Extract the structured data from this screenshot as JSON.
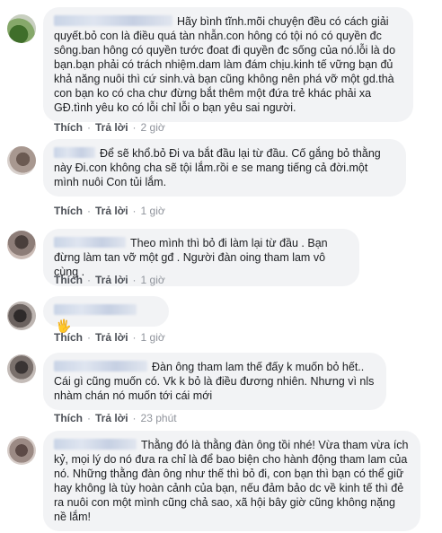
{
  "comments": [
    {
      "text": "Hãy bình tĩnh.mõi chuyện đều có cách giải quyết.bỏ con là điều quá tàn nhẫn.con hông có tội nó có quyền đc sông.ban hông có quyền tước đoat đi quyền đc sống của nó.lỗi là do bạn.bạn phải có trách nhiệm.dam làm đám chịu.kinh tế vững bạn đủ khả năng nuôi thì cứ sinh.và bạn cũng không nên phá vỡ một gd.thà con bạn ko có cha chư đừng bắt thêm một đứa trẻ khác phải xa GĐ.tình yêu ko có lỗi chỉ lỗi o bạn yêu sai người.",
      "like": "Thích",
      "reply": "Trả lời",
      "time": "2 giờ"
    },
    {
      "text": "Để sẽ khổ.bỏ Đi va bắt đầu lại từ đầu. Cố gắng bỏ thằng này Đi.con không cha sẽ tội lắm.rồi e se mang tiếng cả đời.một mình nuôi Con tủi lắm.",
      "like": "Thích",
      "reply": "Trả lời",
      "time": "1 giờ"
    },
    {
      "text": "Theo mình thì bỏ đi làm lại từ đầu . Bạn đừng làm tan vỡ một gđ . Người đàn oing tham lam vô cùng .",
      "like": "Thích",
      "reply": "Trả lời",
      "time": "1 giờ"
    },
    {
      "text": "",
      "emoji": "🖐",
      "like": "Thích",
      "reply": "Trả lời",
      "time": "1 giờ"
    },
    {
      "text": "Đàn ông tham lam thế đấy k muốn bỏ hết.. Cái gì cũng muốn có. Vk k bỏ là điều đương nhiên. Nhưng vì nls nhàm chán nó muốn tới cái mới",
      "like": "Thích",
      "reply": "Trả lời",
      "time": "23 phút"
    },
    {
      "text": "Thằng đó là thằng đàn ông tồi nhé! Vừa tham vừa ích kỷ, mọi lý do nó đưa ra chỉ là để bao biện cho hành động tham lam của nó. Những thằng đàn ông như thế thì bỏ đi, con bạn thì bạn có thể giữ hay không là tùy hoàn cảnh của bạn, nếu đảm bảo dc về kinh tế thì đẻ ra nuôi con một mình cũng chả sao, xã hội bây giờ cũng không nặng nề lắm!"
    }
  ]
}
